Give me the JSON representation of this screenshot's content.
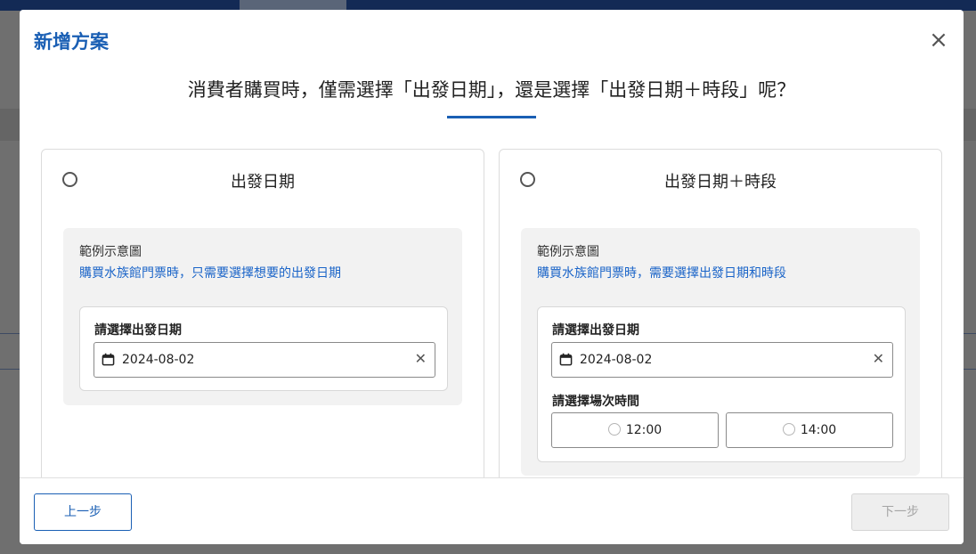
{
  "modal": {
    "title": "新增方案",
    "close_glyph": "×"
  },
  "question": "消費者購買時，僅需選擇「出發日期」，還是選擇「出發日期＋時段」呢？",
  "options": [
    {
      "title": "出發日期",
      "example_label": "範例示意圖",
      "example_desc": "購買水族館門票時，只需要選擇想要的出發日期",
      "picker_label": "請選擇出發日期",
      "date_value": "2024-08-02"
    },
    {
      "title": "出發日期＋時段",
      "example_label": "範例示意圖",
      "example_desc": "購買水族館門票時，需要選擇出發日期和時段",
      "picker_label": "請選擇出發日期",
      "date_value": "2024-08-02",
      "session_label": "請選擇場次時間",
      "slots": [
        "12:00",
        "14:00"
      ]
    }
  ],
  "footer": {
    "prev_label": "上一步",
    "next_label": "下一步"
  },
  "icons": {
    "close": "close-icon",
    "calendar": "calendar-icon",
    "clear": "clear-icon"
  },
  "colors": {
    "accent": "#1a5fb4",
    "link": "#1a64c8",
    "example_bg": "#f2f2f2",
    "disabled_bg": "#eeeeee"
  }
}
